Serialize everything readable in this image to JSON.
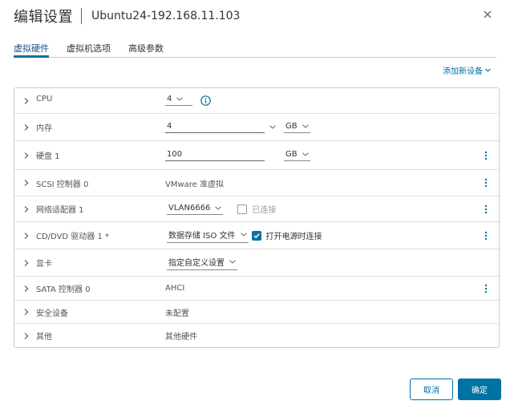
{
  "dialog": {
    "title": "编辑设置",
    "vm_name": "Ubuntu24-192.168.11.103"
  },
  "tabs": [
    {
      "label": "虚拟硬件",
      "active": true
    },
    {
      "label": "虚拟机选项",
      "active": false
    },
    {
      "label": "高级参数",
      "active": false
    }
  ],
  "add_device": {
    "label": "添加新设备"
  },
  "rows": {
    "cpu": {
      "label": "CPU",
      "value": "4"
    },
    "memory": {
      "label": "内存",
      "value": "4",
      "unit": "GB"
    },
    "disk": {
      "label": "硬盘 1",
      "value": "100",
      "unit": "GB"
    },
    "scsi": {
      "label": "SCSI 控制器 0",
      "value": "VMware 准虚拟"
    },
    "network": {
      "label": "网络适配器 1",
      "value": "VLAN6666",
      "checkbox_label": "已连接",
      "checked": false
    },
    "cdrom": {
      "label": "CD/DVD 驱动器 1 *",
      "value": "数据存储 ISO 文件",
      "checkbox_label": "打开电源时连接",
      "checked": true
    },
    "video": {
      "label": "显卡",
      "value": "指定自定义设置"
    },
    "sata": {
      "label": "SATA 控制器 0",
      "value": "AHCI"
    },
    "security": {
      "label": "安全设备",
      "value": "未配置"
    },
    "other": {
      "label": "其他",
      "value": "其他硬件"
    }
  },
  "buttons": {
    "cancel": "取消",
    "ok": "确定"
  },
  "colors": {
    "accent": "#0072a3",
    "border": "#cccccc"
  }
}
